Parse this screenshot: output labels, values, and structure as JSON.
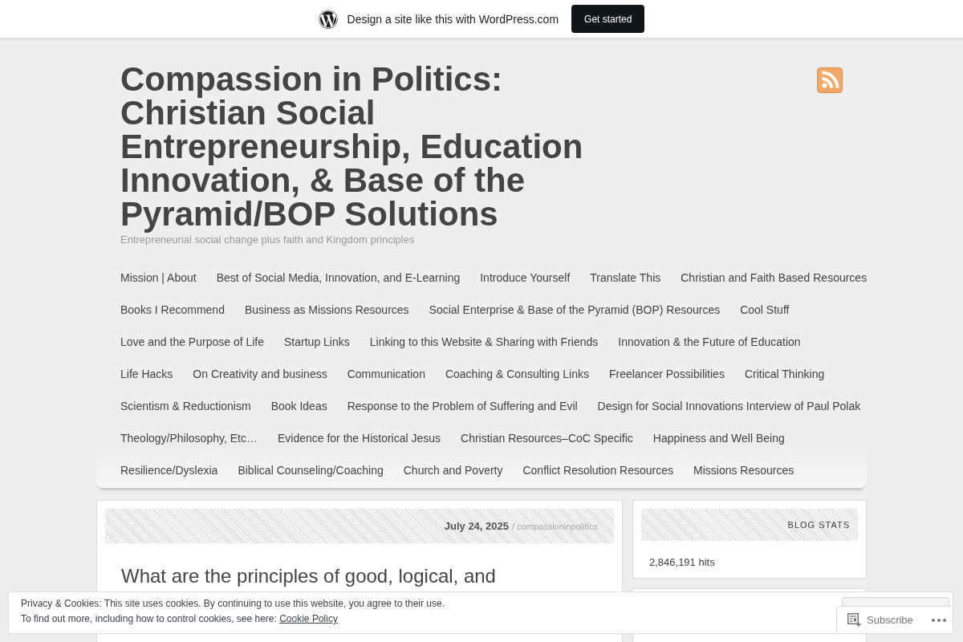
{
  "promo_bar": {
    "text": "Design a site like this with WordPress.com",
    "button": "Get started"
  },
  "site": {
    "title": "Compassion in Politics: Christian Social Entrepreneurship, Education Innovation, & Base of the Pyramid/BOP Solutions",
    "tagline": "Entrepreneurial social change plus faith and Kingdom principles"
  },
  "nav": {
    "items": [
      "Mission | About",
      "Best of Social Media, Innovation, and E-Learning",
      "Introduce Yourself",
      "Translate This",
      "Christian and Faith Based Resources",
      "Books I Recommend",
      "Business as Missions Resources",
      "Social Enterprise & Base of the Pyramid (BOP) Resources",
      "Cool Stuff",
      "Love and the Purpose of Life",
      "Startup Links",
      "Linking to this Website & Sharing with Friends",
      "Innovation & the Future of Education",
      "Life Hacks",
      "On Creativity and business",
      "Communication",
      "Coaching & Consulting Links",
      "Freelancer Possibilities",
      "Critical Thinking",
      "Scientism & Reductionism",
      "Book Ideas",
      "Response to the Problem of Suffering and Evil",
      "Design for Social Innovations Interview of Paul Polak",
      "Theology/Philosophy, Etc…",
      "Evidence for the Historical Jesus",
      "Christian Resources–CoC Specific",
      "Happiness and Well Being",
      "Resilience/Dyslexia",
      "Biblical Counseling/Coaching",
      "Church and Poverty",
      "Conflict Resolution Resources",
      "Missions Resources"
    ]
  },
  "post": {
    "date": "July 24, 2025",
    "separator": "/",
    "author": "compassioninpolitics",
    "title": "What are the principles of good, logical, and"
  },
  "sidebar": {
    "widgets": [
      {
        "title": "BLOG STATS",
        "text": "2,846,191 hits"
      }
    ]
  },
  "cookie_banner": {
    "line_1": "Privacy & Cookies: This site uses cookies. By continuing to use this website, you agree to their use.",
    "line_2": "To find out more, including how to control cookies, see here:",
    "link": "Cookie Policy"
  },
  "subscribe_bar": {
    "button": "Subscribe"
  }
}
